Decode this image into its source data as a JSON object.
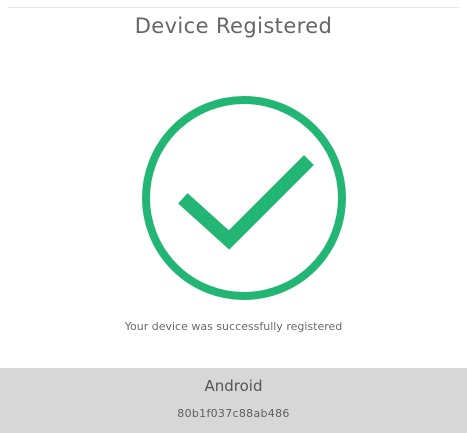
{
  "header": {
    "title": "Device Registered"
  },
  "status": {
    "icon": "check-circle-icon",
    "message": "Your device was successfully registered"
  },
  "device": {
    "platform": "Android",
    "id": "80b1f037c88ab486"
  },
  "colors": {
    "success": "#22b573",
    "panel": "#d7d7d7",
    "text_muted": "#666666"
  }
}
